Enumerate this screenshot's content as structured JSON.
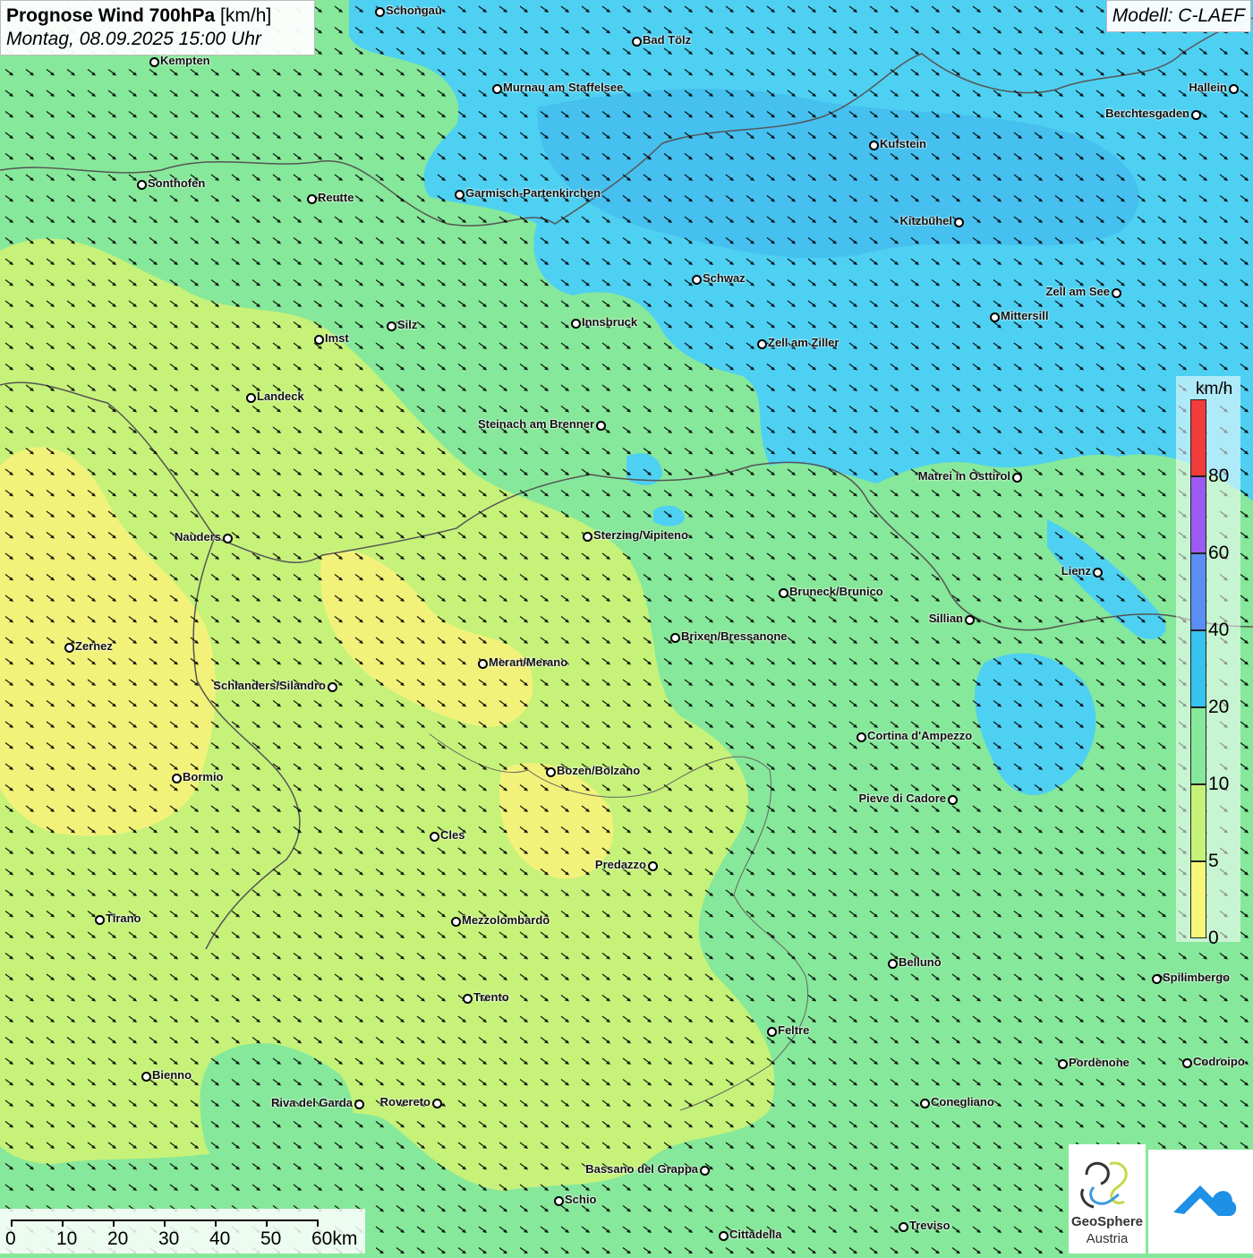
{
  "header": {
    "title_bold": "Prognose Wind 700hPa",
    "title_unit": "[km/h]",
    "datetime": "Montag, 08.09.2025 15:00 Uhr",
    "model": "Modell: C-LAEF"
  },
  "colors": {
    "yellow_0_5": "#f2f27a",
    "yellowgreen_5_10": "#c6f27a",
    "green_10_20": "#86e89a",
    "cyan_20_40": "#4ed0f2",
    "blue_40_60": "#5b8ef2",
    "purple_60_80": "#9b5bf2",
    "red_80": "#f23b3b"
  },
  "legend": {
    "unit": "km/h",
    "ticks": [
      "80",
      "60",
      "40",
      "20",
      "10",
      "5",
      "0"
    ],
    "segment_colors": [
      "#f23b3b",
      "#9b5bf2",
      "#5b8ef2",
      "#36c3f0",
      "#86e89a",
      "#c6f27a",
      "#f7f77a"
    ]
  },
  "scale_bar": {
    "labels": [
      "0",
      "10",
      "20",
      "30",
      "40",
      "50",
      "60km"
    ]
  },
  "logos": {
    "geosphere_name": "GeoSphere",
    "geosphere_sub": "Austria",
    "geosphere_icon": "geosphere-logo-icon",
    "app_icon": "cloud-arrow-logo-icon"
  },
  "cities": [
    {
      "name": "Schongau"
    },
    {
      "name": "Bad Tölz"
    },
    {
      "name": "Kempten"
    },
    {
      "name": "Murnau am Staffelsee"
    },
    {
      "name": "Hallein"
    },
    {
      "name": "Berchtesgaden"
    },
    {
      "name": "Kufstein"
    },
    {
      "name": "Sonthofen"
    },
    {
      "name": "Reutte"
    },
    {
      "name": "Garmisch-Partenkirchen"
    },
    {
      "name": "Kitzbühel"
    },
    {
      "name": "Schwaz"
    },
    {
      "name": "Zell am See"
    },
    {
      "name": "Mittersill"
    },
    {
      "name": "Innsbruck"
    },
    {
      "name": "Silz"
    },
    {
      "name": "Imst"
    },
    {
      "name": "Zell am Ziller"
    },
    {
      "name": "Landeck"
    },
    {
      "name": "Steinach am Brenner"
    },
    {
      "name": "Matrei in Osttirol"
    },
    {
      "name": "Nauders"
    },
    {
      "name": "Sterzing/Vipiteno"
    },
    {
      "name": "Lienz"
    },
    {
      "name": "Bruneck/Brunico"
    },
    {
      "name": "Sillian"
    },
    {
      "name": "Brixen/Bressanone"
    },
    {
      "name": "Zernez"
    },
    {
      "name": "Meran/Merano"
    },
    {
      "name": "Schlanders/Silandro"
    },
    {
      "name": "Cortina d'Ampezzo"
    },
    {
      "name": "Bozen/Bolzano"
    },
    {
      "name": "Bormio"
    },
    {
      "name": "Pieve di Cadore"
    },
    {
      "name": "Cles"
    },
    {
      "name": "Predazzo"
    },
    {
      "name": "Tirano"
    },
    {
      "name": "Mezzolombardo"
    },
    {
      "name": "Belluno"
    },
    {
      "name": "Spilimbergo"
    },
    {
      "name": "Trento"
    },
    {
      "name": "Feltre"
    },
    {
      "name": "Pordenone"
    },
    {
      "name": "Codroipo"
    },
    {
      "name": "Bienno"
    },
    {
      "name": "Riva del Garda"
    },
    {
      "name": "Rovereto"
    },
    {
      "name": "Conegliano"
    },
    {
      "name": "Bassano del Grappa"
    },
    {
      "name": "Schio"
    },
    {
      "name": "Treviso"
    },
    {
      "name": "Cittadella"
    }
  ]
}
